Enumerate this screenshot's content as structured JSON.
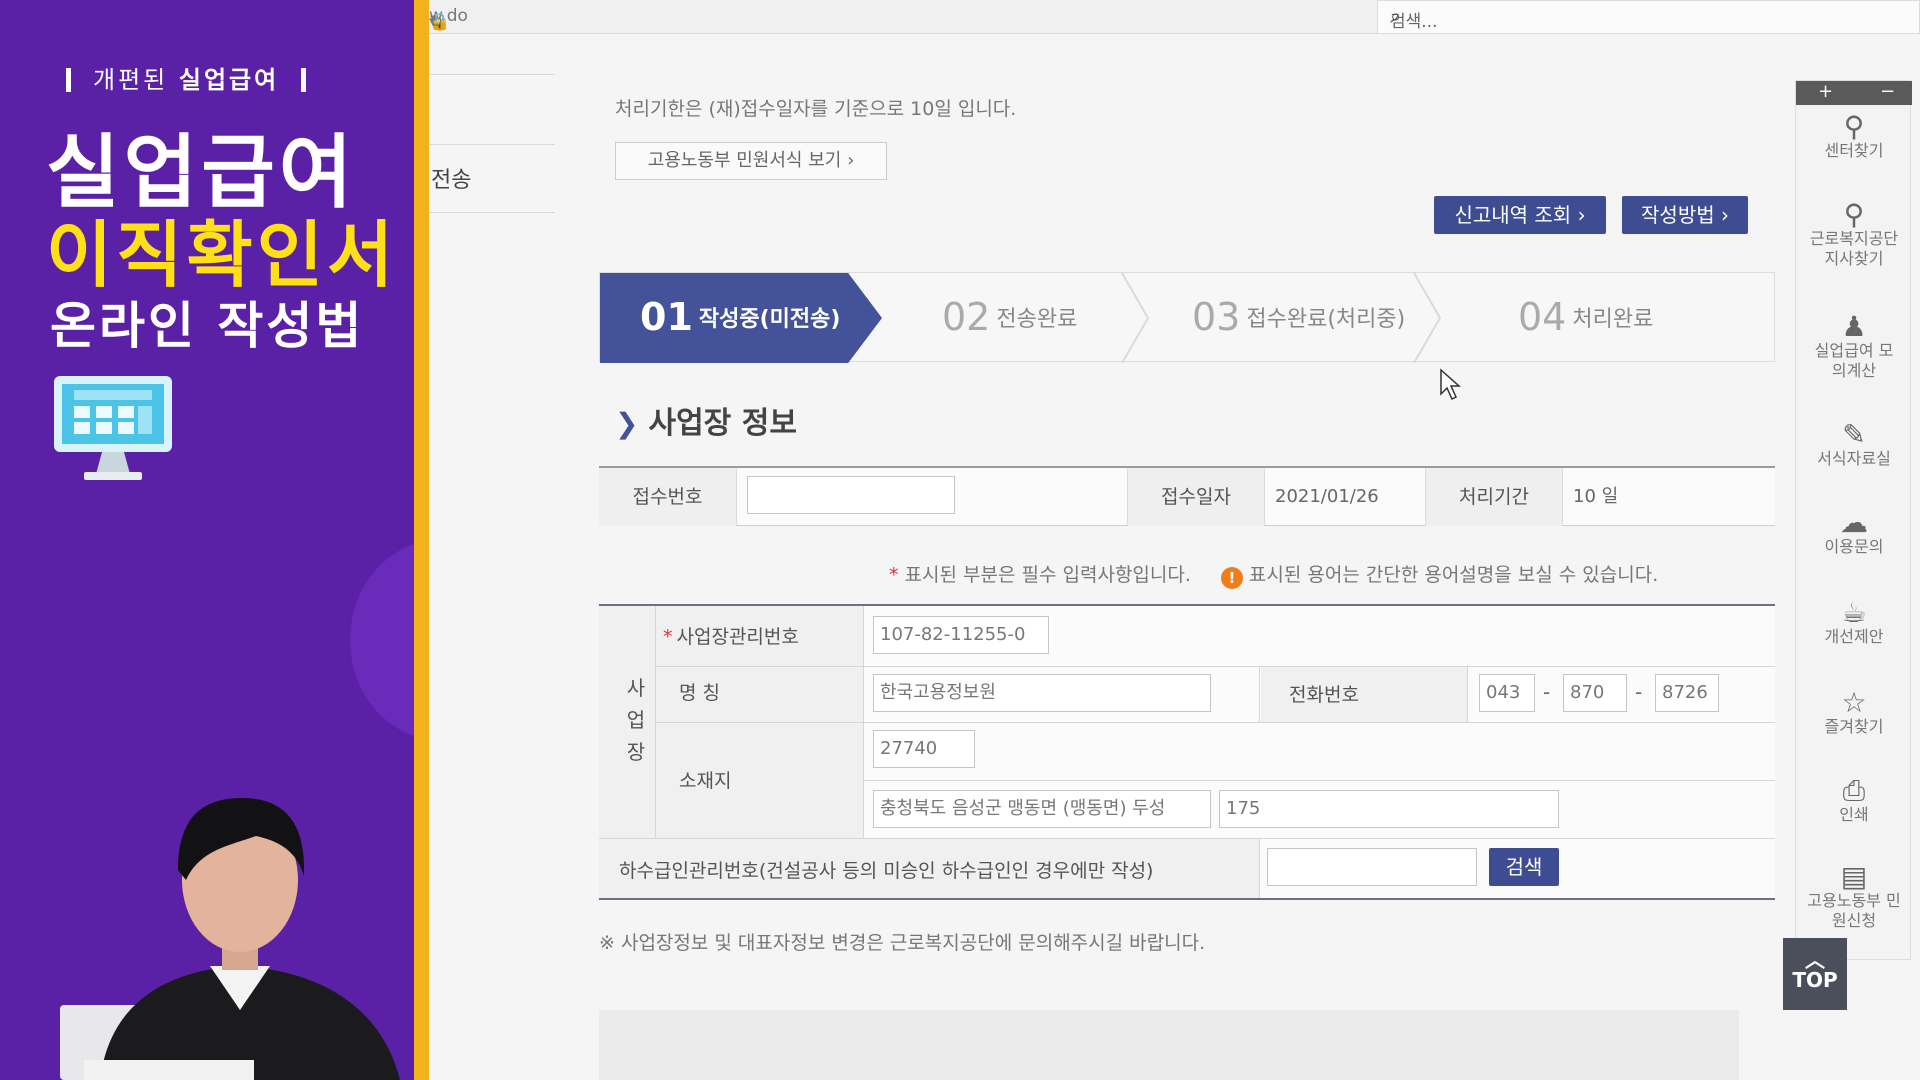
{
  "promo": {
    "sub_head_pre": "개편된",
    "sub_head_bold": "실업급여",
    "title_line1": "실업급여",
    "title_line2": "이직확인서",
    "title_line3": "온라인 작성법"
  },
  "browser": {
    "url_fragment": "w.do",
    "search_placeholder": "검색...",
    "left_nav_item": "전송"
  },
  "page": {
    "notice": "처리기한은 (재)접수일자를 기준으로 10일 입니다.",
    "form_view_button": "고용노동부 민원서식 보기",
    "report_history_button": "신고내역 조회",
    "how_to_button": "작성방법",
    "steps": [
      {
        "num": "01",
        "label": "작성중(미전송)"
      },
      {
        "num": "02",
        "label": "전송완료"
      },
      {
        "num": "03",
        "label": "접수완료(처리중)"
      },
      {
        "num": "04",
        "label": "처리완료"
      }
    ],
    "section_title": "사업장 정보",
    "info": {
      "receipt_no_label": "접수번호",
      "receipt_no_value": "",
      "receipt_date_label": "접수일자",
      "receipt_date_value": "2021/01/26",
      "period_label": "처리기간",
      "period_value": "10 일"
    },
    "required_note": "표시된 부분은 필수 입력사항입니다.",
    "term_note": "표시된 용어는 간단한 용어설명을 보실 수 있습니다.",
    "workplace": {
      "group_label": "사업장",
      "mgmt_no_label": "사업장관리번호",
      "mgmt_no_value": "107-82-11255-0",
      "name_label": "명 칭",
      "name_value": "한국고용정보원",
      "phone_label": "전화번호",
      "phone_1": "043",
      "phone_2": "870",
      "phone_3": "8726",
      "address_label": "소재지",
      "zip_value": "27740",
      "address_value": "충청북도 음성군 맹동면 (맹동면) 두성",
      "address_detail_value": "175"
    },
    "subcontract_label": "하수급인관리번호(건설공사 등의 미승인 하수급인인 경우에만 작성)",
    "subcontract_value": "",
    "search_button": "검색",
    "footer_note": "※ 사업장정보 및 대표자정보 변경은 근로복지공단에 문의해주시길 바랍니다."
  },
  "quick_menu": {
    "plus": "+",
    "minus": "−",
    "items": [
      {
        "icon": "map-pin-icon",
        "label": "센터찾기"
      },
      {
        "icon": "map-pin-icon",
        "label": "근로복지공단 지사찾기"
      },
      {
        "icon": "person-icon",
        "label": "실업급여 모의계산"
      },
      {
        "icon": "edit-icon",
        "label": "서식자료실"
      },
      {
        "icon": "chat-icon",
        "label": "이용문의"
      },
      {
        "icon": "cup-icon",
        "label": "개선제안"
      },
      {
        "icon": "star-icon",
        "label": "즐겨찾기"
      },
      {
        "icon": "printer-icon",
        "label": "인쇄"
      },
      {
        "icon": "document-icon",
        "label": "고용노동부 민원신청"
      }
    ],
    "top_label": "TOP"
  },
  "colors": {
    "promo_bg": "#5a21a6",
    "promo_accent": "#ffdf16",
    "promo_bar": "#f3b21b",
    "step_active": "#44529a",
    "button_blue": "#3e4d91"
  }
}
